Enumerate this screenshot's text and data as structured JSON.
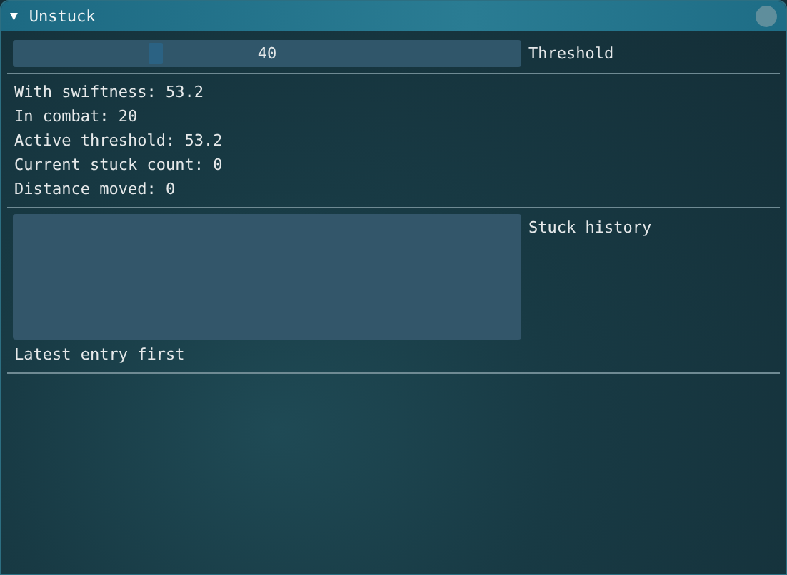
{
  "window": {
    "title": "Unstuck",
    "collapse_icon": "▼",
    "expanded": true
  },
  "threshold_slider": {
    "value": "40",
    "label": "Threshold",
    "level": 0.28
  },
  "stats": [
    "With swiftness: 53.2",
    "In combat: 20",
    "Active threshold: 53.2",
    "Current stuck count: 0",
    "Distance moved: 0"
  ],
  "stuck_history": {
    "label": "Stuck history",
    "hint": "Latest entry first"
  }
}
